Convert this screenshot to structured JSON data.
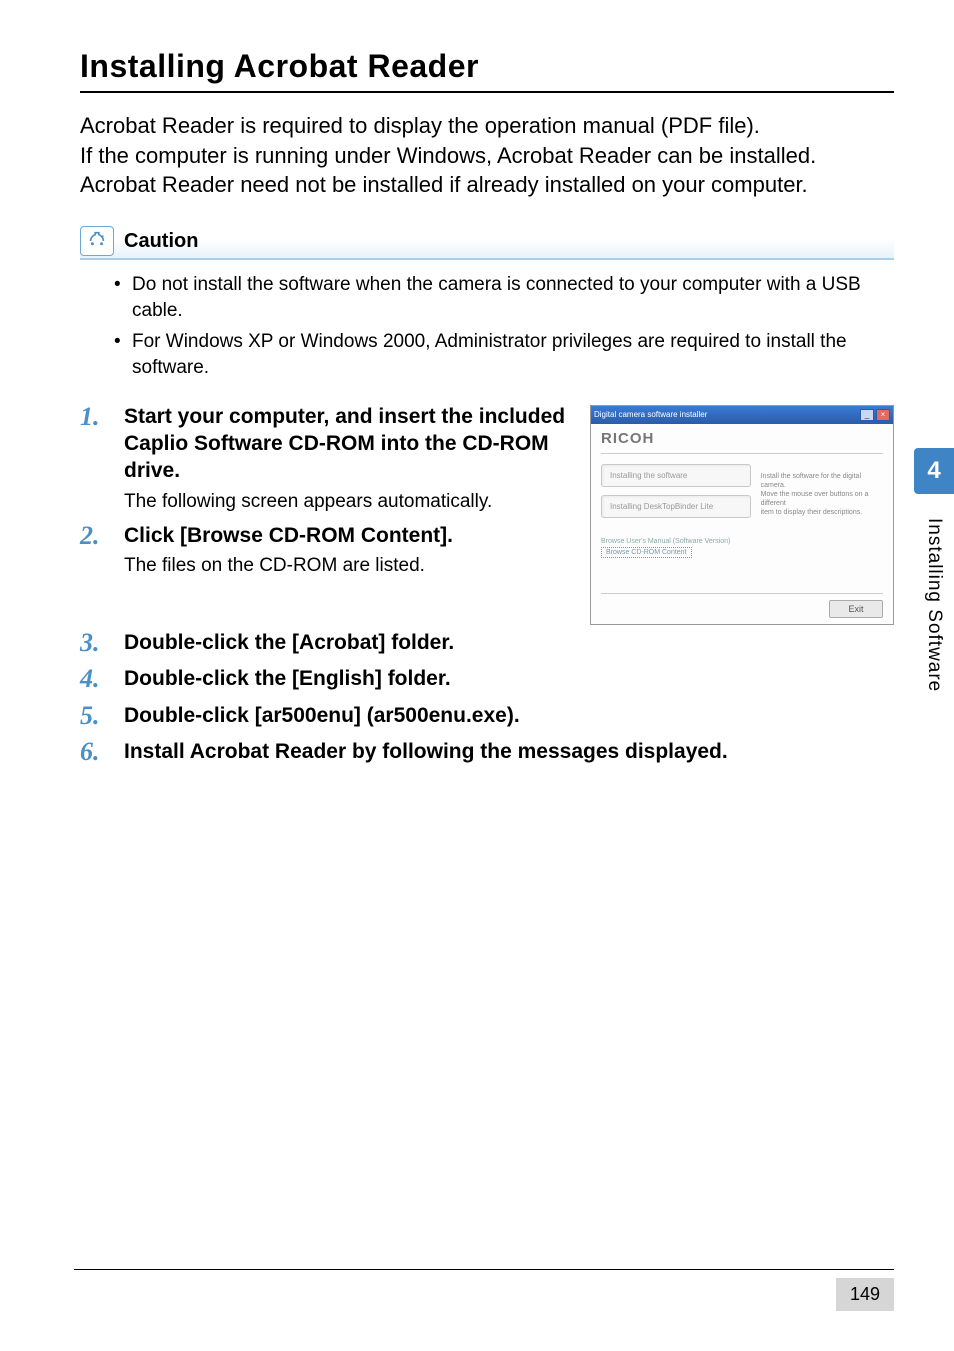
{
  "heading": "Installing Acrobat Reader",
  "intro": "Acrobat Reader is required to display the operation manual (PDF file).\nIf the computer is running under Windows, Acrobat Reader can be installed.\nAcrobat Reader need not be installed if already installed on your computer.",
  "caution_label": "Caution",
  "cautions": [
    "Do not install the software when the camera is connected to your computer with a USB cable.",
    "For Windows XP or Windows 2000, Administrator privileges are required to install the software."
  ],
  "steps": [
    {
      "n": "1.",
      "title": "Start your computer, and insert the included Caplio Software CD-ROM into the CD-ROM drive.",
      "desc": "The following screen appears automatically."
    },
    {
      "n": "2.",
      "title": "Click [Browse CD-ROM Content].",
      "desc": "The files on the CD-ROM are listed."
    },
    {
      "n": "3.",
      "title": "Double-click the [Acrobat] folder.",
      "desc": ""
    },
    {
      "n": "4.",
      "title": "Double-click the [English] folder.",
      "desc": ""
    },
    {
      "n": "5.",
      "title": "Double-click [ar500enu] (ar500enu.exe).",
      "desc": ""
    },
    {
      "n": "6.",
      "title": "Install Acrobat Reader by following the messages displayed.",
      "desc": ""
    }
  ],
  "installer": {
    "window_title": "Digital camera software installer",
    "logo": "RICOH",
    "box1": "Installing the software",
    "box2": "Installing DeskTopBinder Lite",
    "link1": "Browse User's Manual (Software Version)",
    "link2": "Browse CD-ROM Content",
    "right_text": "Install the software for the digital camera.\nMove the mouse over buttons on a different\nitem to display their descriptions.",
    "exit": "Exit"
  },
  "chapter_number": "4",
  "chapter_title": "Installing Software",
  "page_number": "149"
}
